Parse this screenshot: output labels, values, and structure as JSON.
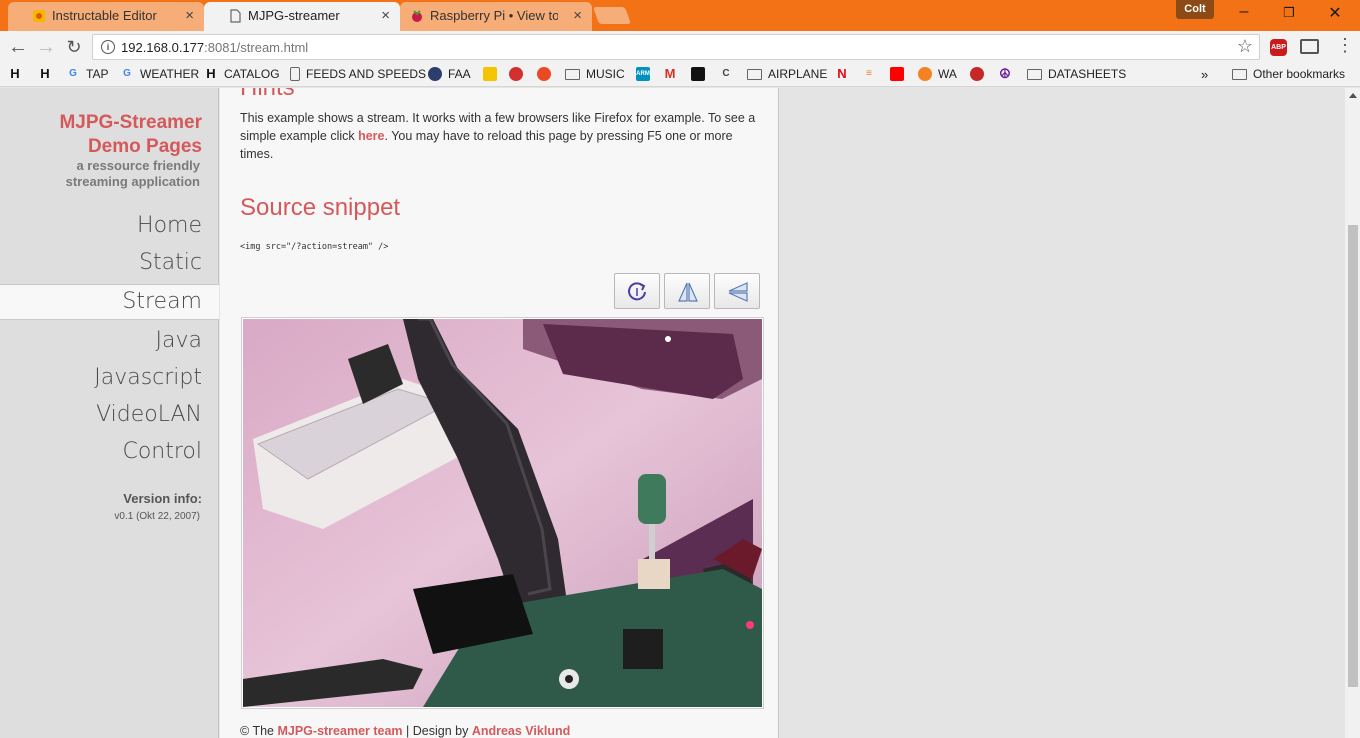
{
  "browser": {
    "tabs": [
      {
        "title": "Instructable Editor",
        "close": "×"
      },
      {
        "title": "MJPG-streamer",
        "close": "×"
      },
      {
        "title": "Raspberry Pi • View topic",
        "close": "×"
      }
    ],
    "profile_name": "Colt",
    "url_host": "192.168.0.177",
    "url_rest": ":8081/stream.html",
    "bookmarks": [
      "TAP",
      "WEATHER",
      "CATALOG",
      "FEEDS AND SPEEDS",
      "FAA",
      "MUSIC",
      "AIRPLANE",
      "WA",
      "DATASHEETS"
    ],
    "other_bookmarks": "Other bookmarks",
    "overflow": "»",
    "accent_color": "#f47216"
  },
  "sidebar": {
    "brand_line1": "MJPG-Streamer",
    "brand_line2": "Demo Pages",
    "tagline_line1": "a ressource friendly",
    "tagline_line2": "streaming application",
    "nav": [
      "Home",
      "Static",
      "Stream",
      "Java",
      "Javascript",
      "VideoLAN",
      "Control"
    ],
    "active_nav": "Stream",
    "version_label": "Version info:",
    "version_value": "v0.1 (Okt 22, 2007)"
  },
  "content": {
    "hints_heading": "Hints",
    "hint_text_1": "This example shows a stream. It works with a few browsers like Firefox for example. To see a simple example click ",
    "hint_link": "here",
    "hint_text_2": ". You may have to reload this page by pressing F5 one or more times.",
    "snippet_heading": "Source snippet",
    "snippet_code": "<img src=\"/?action=stream\" />",
    "footer_prefix": "© The ",
    "footer_team": "MJPG-streamer team",
    "footer_mid": " | Design by ",
    "footer_designer": "Andreas Viklund",
    "brand_color": "#d5595b"
  }
}
